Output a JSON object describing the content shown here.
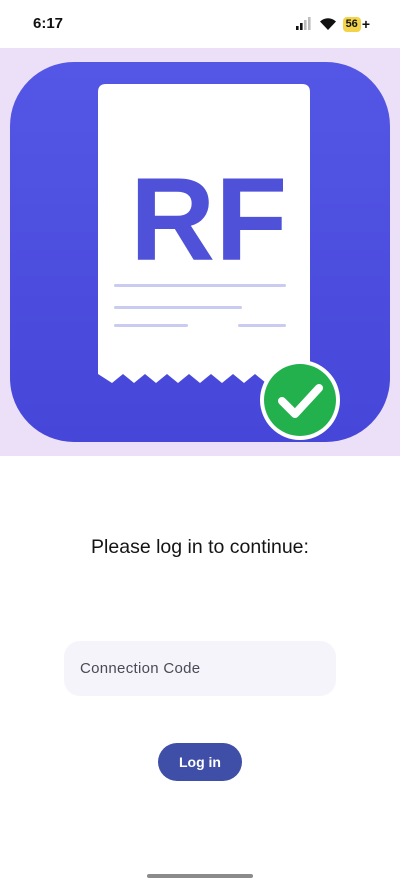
{
  "status_bar": {
    "time": "6:17",
    "battery_level": "56",
    "battery_suffix": "+"
  },
  "logo": {
    "text": "RF",
    "icon": "receipt-check-logo",
    "colors": {
      "background": "#4a4fe0",
      "receipt": "#ffffff",
      "text": "#4f52d9",
      "check_badge": "#23b14d"
    }
  },
  "login": {
    "prompt": "Please log in to continue:",
    "code_placeholder": "Connection Code",
    "code_value": "",
    "login_label": "Log in"
  },
  "colors": {
    "hero_background": "#ece0f9",
    "button": "#3f4ea6",
    "input_background": "#f5f4fb"
  }
}
